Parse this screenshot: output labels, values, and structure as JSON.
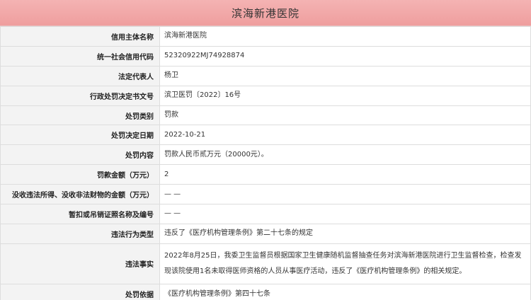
{
  "header": {
    "title": "滨海新港医院"
  },
  "rows": [
    {
      "label": "信用主体名称",
      "value": "滨海新港医院"
    },
    {
      "label": "统一社会信用代码",
      "value": "52320922MJ74928874"
    },
    {
      "label": "法定代表人",
      "value": "杨卫"
    },
    {
      "label": "行政处罚决定书文号",
      "value": "滨卫医罚〔2022〕16号"
    },
    {
      "label": "处罚类别",
      "value": "罚款"
    },
    {
      "label": "处罚决定日期",
      "value": "2022-10-21"
    },
    {
      "label": "处罚内容",
      "value": "罚款人民币贰万元（20000元）。"
    },
    {
      "label": "罚款金额（万元）",
      "value": "2"
    },
    {
      "label": "没收违法所得、没收非法财物的金额（万元）",
      "value": "— —"
    },
    {
      "label": "暂扣或吊销证照名称及编号",
      "value": "— —"
    },
    {
      "label": "违法行为类型",
      "value": "违反了《医疗机构管理条例》第二十七条的规定"
    },
    {
      "label": "违法事实",
      "value": "2022年8月25日，我委卫生监督员根据国家卫生健康随机监督抽查任务对滨海新港医院进行卫生监督检查，检查发现该院使用1名未取得医师资格的人员从事医疗活动，违反了《医疗机构管理条例》的相关规定。"
    },
    {
      "label": "处罚依据",
      "value": "《医疗机构管理条例》第四十七条"
    }
  ]
}
